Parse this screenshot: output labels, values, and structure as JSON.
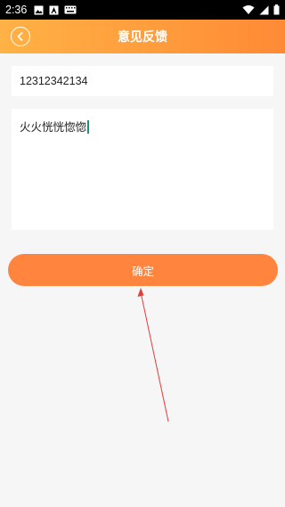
{
  "status_bar": {
    "time": "2:36"
  },
  "header": {
    "title": "意见反馈"
  },
  "form": {
    "phone_value": "12312342134",
    "content_value": "火火恍恍惚惚"
  },
  "submit_label": "确定"
}
